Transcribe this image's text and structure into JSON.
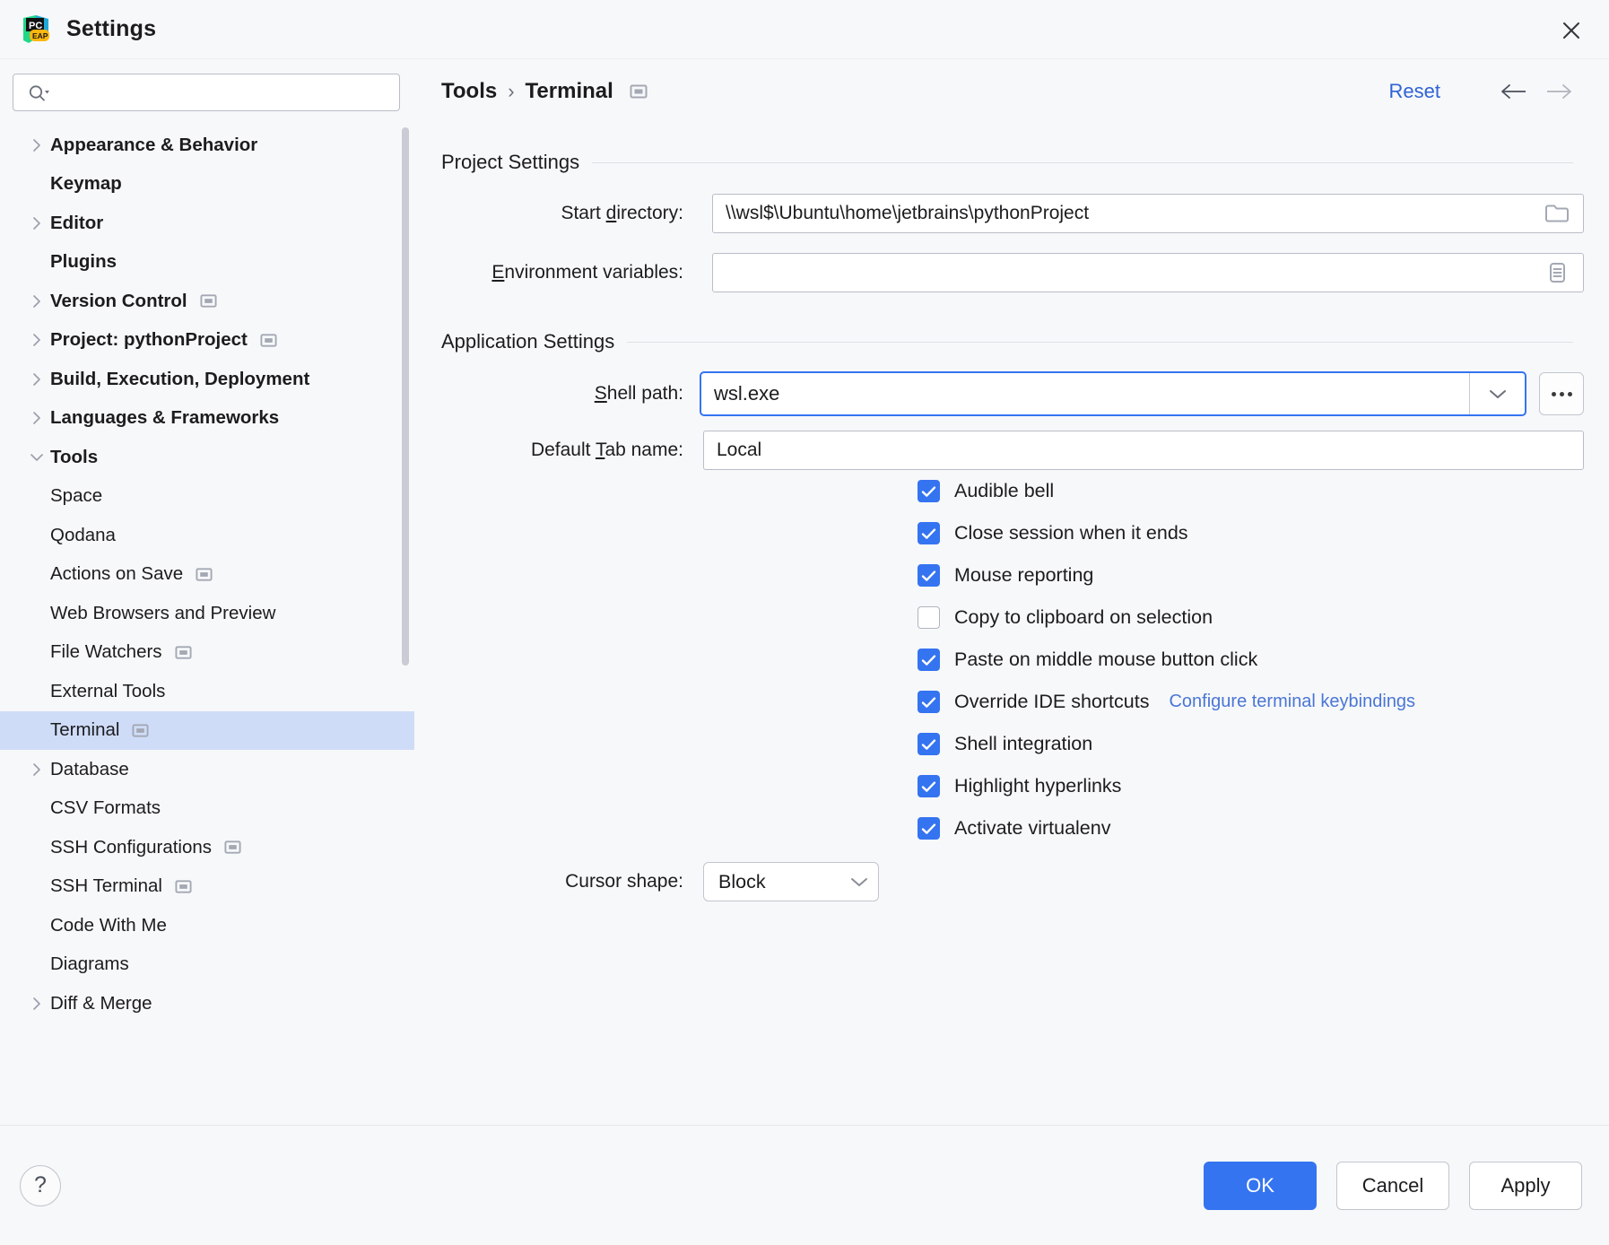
{
  "window": {
    "title": "Settings",
    "logo_text_top": "PC",
    "logo_text_bottom": "EAP",
    "close_icon": "close-icon"
  },
  "search": {
    "value": "",
    "placeholder": "",
    "icon": "search-icon"
  },
  "sidebar": {
    "items": [
      {
        "label": "Appearance & Behavior",
        "level": 0,
        "twisty": "collapsed",
        "badge": false,
        "selected": false
      },
      {
        "label": "Keymap",
        "level": 0,
        "twisty": "none",
        "badge": false,
        "selected": false
      },
      {
        "label": "Editor",
        "level": 0,
        "twisty": "collapsed",
        "badge": false,
        "selected": false
      },
      {
        "label": "Plugins",
        "level": 0,
        "twisty": "none",
        "badge": false,
        "selected": false
      },
      {
        "label": "Version Control",
        "level": 0,
        "twisty": "collapsed",
        "badge": true,
        "selected": false
      },
      {
        "label": "Project: pythonProject",
        "level": 0,
        "twisty": "collapsed",
        "badge": true,
        "selected": false
      },
      {
        "label": "Build, Execution, Deployment",
        "level": 0,
        "twisty": "collapsed",
        "badge": false,
        "selected": false
      },
      {
        "label": "Languages & Frameworks",
        "level": 0,
        "twisty": "collapsed",
        "badge": false,
        "selected": false
      },
      {
        "label": "Tools",
        "level": 0,
        "twisty": "expanded",
        "badge": false,
        "selected": false
      },
      {
        "label": "Space",
        "level": 1,
        "twisty": "none",
        "badge": false,
        "selected": false
      },
      {
        "label": "Qodana",
        "level": 1,
        "twisty": "none",
        "badge": false,
        "selected": false
      },
      {
        "label": "Actions on Save",
        "level": 1,
        "twisty": "none",
        "badge": true,
        "selected": false
      },
      {
        "label": "Web Browsers and Preview",
        "level": 1,
        "twisty": "none",
        "badge": false,
        "selected": false
      },
      {
        "label": "File Watchers",
        "level": 1,
        "twisty": "none",
        "badge": true,
        "selected": false
      },
      {
        "label": "External Tools",
        "level": 1,
        "twisty": "none",
        "badge": false,
        "selected": false
      },
      {
        "label": "Terminal",
        "level": 1,
        "twisty": "none",
        "badge": true,
        "selected": true
      },
      {
        "label": "Database",
        "level": 1,
        "twisty": "collapsed",
        "badge": false,
        "selected": false
      },
      {
        "label": "CSV Formats",
        "level": 1,
        "twisty": "none",
        "badge": false,
        "selected": false
      },
      {
        "label": "SSH Configurations",
        "level": 1,
        "twisty": "none",
        "badge": true,
        "selected": false
      },
      {
        "label": "SSH Terminal",
        "level": 1,
        "twisty": "none",
        "badge": true,
        "selected": false
      },
      {
        "label": "Code With Me",
        "level": 1,
        "twisty": "none",
        "badge": false,
        "selected": false
      },
      {
        "label": "Diagrams",
        "level": 1,
        "twisty": "none",
        "badge": false,
        "selected": false
      },
      {
        "label": "Diff & Merge",
        "level": 1,
        "twisty": "collapsed",
        "badge": false,
        "selected": false
      }
    ]
  },
  "breadcrumb": {
    "root": "Tools",
    "separator": "›",
    "leaf": "Terminal",
    "badge_icon": "project-scope-icon"
  },
  "header": {
    "reset_label": "Reset",
    "back_icon": "arrow-left-icon",
    "forward_icon": "arrow-right-icon"
  },
  "project_settings": {
    "title": "Project Settings",
    "start_directory": {
      "label_pre": "Start ",
      "label_mn": "d",
      "label_post": "irectory:",
      "value": "\\\\wsl$\\Ubuntu\\home\\jetbrains\\pythonProject",
      "trailing_icon": "folder-icon"
    },
    "environment_variables": {
      "label_pre": "",
      "label_mn": "E",
      "label_post": "nvironment variables:",
      "value": "",
      "trailing_icon": "list-edit-icon"
    }
  },
  "application_settings": {
    "title": "Application Settings",
    "shell_path": {
      "label_pre": "",
      "label_mn": "S",
      "label_post": "hell path:",
      "value": "wsl.exe",
      "dropdown_icon": "chevron-down-icon",
      "browse_label": "...",
      "focused": true
    },
    "default_tab_name": {
      "label_pre": "Default ",
      "label_mn": "T",
      "label_post": "ab name:",
      "value": "Local"
    },
    "checkboxes": [
      {
        "label": "Audible bell",
        "checked": true,
        "link": null
      },
      {
        "label": "Close session when it ends",
        "checked": true,
        "link": null
      },
      {
        "label": "Mouse reporting",
        "checked": true,
        "link": null
      },
      {
        "label": "Copy to clipboard on selection",
        "checked": false,
        "link": null
      },
      {
        "label": "Paste on middle mouse button click",
        "checked": true,
        "link": null
      },
      {
        "label": "Override IDE shortcuts",
        "checked": true,
        "link": "Configure terminal keybindings"
      },
      {
        "label": "Shell integration",
        "checked": true,
        "link": null
      },
      {
        "label": "Highlight hyperlinks",
        "checked": true,
        "link": null
      },
      {
        "label": "Activate virtualenv",
        "checked": true,
        "link": null
      }
    ],
    "cursor_shape": {
      "label": "Cursor shape:",
      "value": "Block",
      "dropdown_icon": "chevron-down-icon"
    }
  },
  "footer": {
    "help_label": "?",
    "ok_label": "OK",
    "cancel_label": "Cancel",
    "apply_label": "Apply"
  },
  "colors": {
    "accent": "#3574f0",
    "link": "#2f63d4",
    "selection": "#cfdcf8",
    "background": "#f7f8fa"
  }
}
